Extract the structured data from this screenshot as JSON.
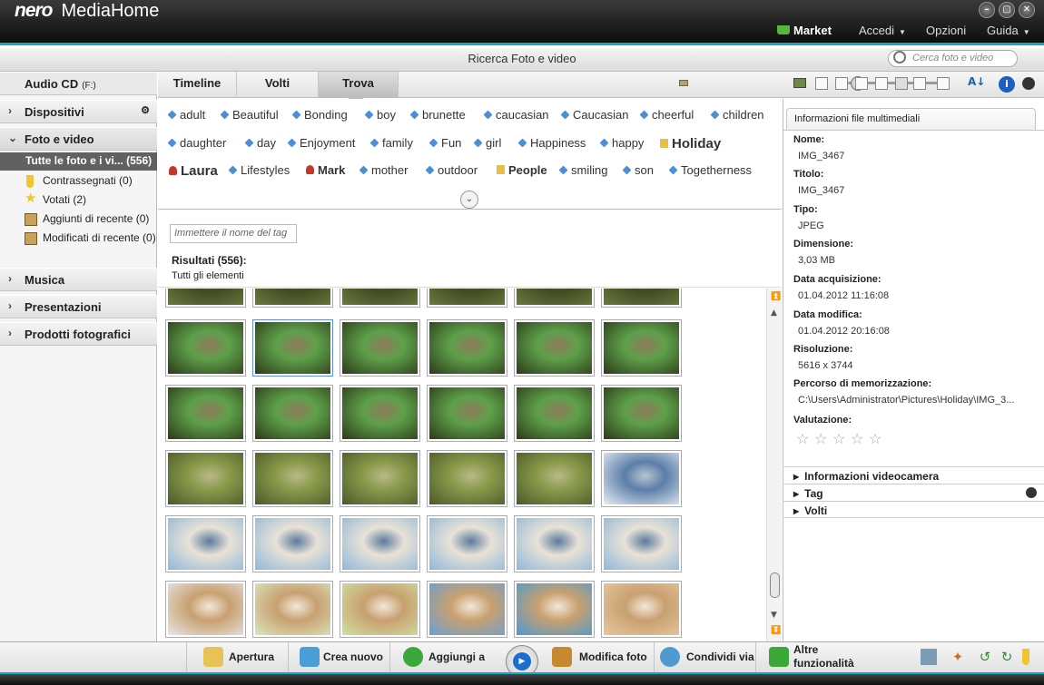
{
  "app": {
    "brand": "nero",
    "name": "MediaHome"
  },
  "window_controls": {
    "minimize": "–",
    "restore": "▢",
    "close": "✕"
  },
  "top_menu": {
    "market": "Market",
    "login": "Accedi",
    "options": "Opzioni",
    "help": "Guida",
    "dropdown_glyph": "▼"
  },
  "subheader": {
    "title": "Ricerca Foto e video",
    "search_placeholder": "Cerca foto e video"
  },
  "sidebar": {
    "audio_cd": "Audio CD",
    "audio_cd_drive": "(F:)",
    "devices": "Dispositivi",
    "photos": "Foto e video",
    "all_photos": "Tutte le foto e i vi... (556)",
    "subitems": [
      {
        "label": "Contrassegnati (0)",
        "icon": "tag-icon"
      },
      {
        "label": "Votati (2)",
        "icon": "star-icon"
      },
      {
        "label": "Aggiunti di recente (0)",
        "icon": "album-icon"
      },
      {
        "label": "Modificati di recente (0)",
        "icon": "album-icon"
      }
    ],
    "music": "Musica",
    "presentations": "Presentazioni",
    "photo_products": "Prodotti fotografici"
  },
  "tabs": [
    "Timeline",
    "Volti",
    "Trova"
  ],
  "tags": {
    "row1": [
      "adult",
      "Beautiful",
      "Bonding",
      "boy",
      "brunette",
      "caucasian",
      "Caucasian",
      "cheerful",
      "children"
    ],
    "row2": [
      "daughter",
      "day",
      "Enjoyment",
      "family",
      "Fun",
      "girl",
      "Happiness",
      "happy",
      "Holiday"
    ],
    "row3": [
      "Laura",
      "Lifestyles",
      "Mark",
      "mother",
      "outdoor",
      "People",
      "smiling",
      "son",
      "Togetherness"
    ]
  },
  "filter": {
    "placeholder": "Immettere il nome del tag"
  },
  "results": {
    "title": "Risultati (556):",
    "subtitle": "Tutti gli elementi"
  },
  "info_panel": {
    "tab": "Informazioni file multimediali",
    "fields": [
      {
        "label": "Nome:",
        "value": "IMG_3467"
      },
      {
        "label": "Titolo:",
        "value": "IMG_3467"
      },
      {
        "label": "Tipo:",
        "value": "JPEG"
      },
      {
        "label": "Dimensione:",
        "value": "3,03 MB"
      },
      {
        "label": "Data acquisizione:",
        "value": "01.04.2012 11:16:08"
      },
      {
        "label": "Data modifica:",
        "value": "01.04.2012 20:16:08"
      },
      {
        "label": "Risoluzione:",
        "value": "5616 x 3744"
      },
      {
        "label": "Percorso di memorizzazione:",
        "value": "C:\\Users\\Administrator\\Pictures\\Holiday\\IMG_3..."
      }
    ],
    "rating_label": "Valutazione:",
    "rating": 0,
    "star_glyph": "☆",
    "sections": [
      "Informazioni videocamera",
      "Tag",
      "Volti"
    ]
  },
  "bottom_toolbar": {
    "open": "Apertura",
    "create": "Crea nuovo",
    "add": "Aggiungi a",
    "edit": "Modifica foto",
    "share": "Condividi via",
    "more_line1": "Altre",
    "more_line2": "funzionalità"
  },
  "colors": {
    "accent": "#16a6c5",
    "titlebar": "#1a1a1a",
    "selected_item": "#616161",
    "tag_icon": "#4c8fd6"
  }
}
